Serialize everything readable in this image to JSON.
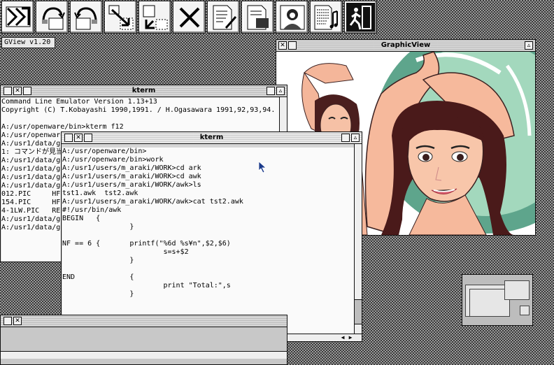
{
  "toolbar": {
    "icons": [
      "app-logo-icon",
      "fold-up-icon",
      "fold-down-icon",
      "shrink-window-icon",
      "expand-window-icon",
      "close-x-icon",
      "document-edit-icon",
      "document-image-icon",
      "portrait-image-icon",
      "music-sheet-icon",
      "exit-door-icon"
    ]
  },
  "gview_label": "GView v1.20",
  "kterm_back": {
    "title": "kterm",
    "lines": [
      "Command Line Emulator Version 1.13+13",
      "Copyright (C) T.Kobayashi 1990,1991. / H.Ogasawara 1991,92,93,94.",
      "",
      "A:/usr/openware/bin>kterm f12",
      "A:/usr/openware/bin>ktemp f12",
      "A:/usr1/data/grap",
      "1: コマンドが見当",
      "A:/usr1/data/grap",
      "A:/usr1/data/grap",
      "A:/usr1/data/grap",
      "A:/usr1/data/grap",
      "012.PIC     HF1.P",
      "154.PIC     HF2.P",
      "4-1LW.PIC   REIKO",
      "A:/usr1/data/grap",
      "A:/usr1/data/grap"
    ]
  },
  "kterm_front": {
    "title": "kterm",
    "lines": [
      "A:/usr/openware/bin>",
      "A:/usr/openware/bin>work",
      "A:/usr1/users/m_araki/WORK>cd ark",
      "A:/usr1/users/m_araki/WORK>cd awk",
      "A:/usr1/users/m_araki/WORK/awk>ls",
      "tst1.awk  tst2.awk",
      "A:/usr1/users/m_araki/WORK/awk>cat tst2.awk",
      "#!/usr/bin/awk",
      "BEGIN   {",
      "                }",
      "",
      "NF == 6 {       printf(\"%6d %s¥n\",$2,$6)",
      "                        s=s+$2",
      "                }",
      "",
      "END             {",
      "                        print \"Total:\",s",
      "                }",
      "",
      "",
      "",
      ""
    ],
    "prompt": "A:/usr1/users/m_araki/WORK/awk>"
  },
  "graphic_view": {
    "title": "GraphicView"
  }
}
